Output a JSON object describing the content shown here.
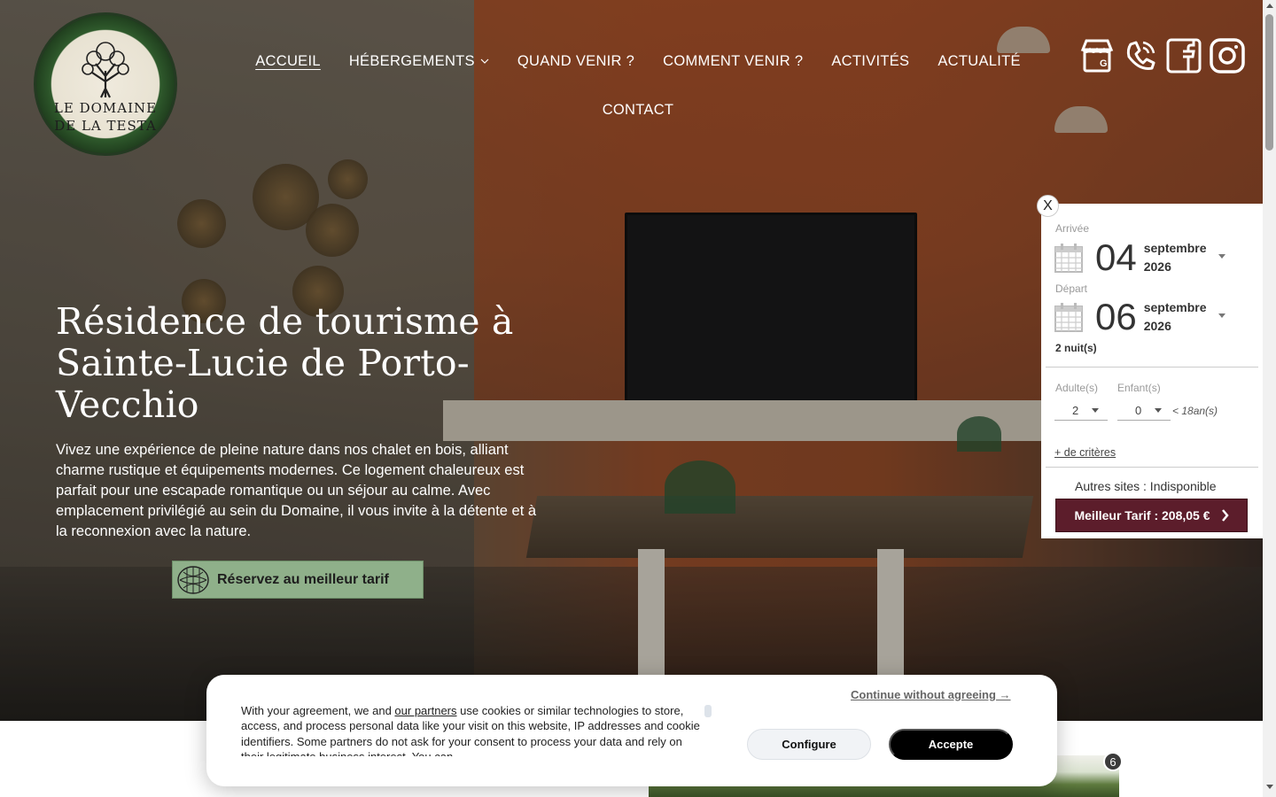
{
  "logo": {
    "line1": "Le Domaine",
    "line2": "de la Testa"
  },
  "nav": {
    "items": [
      {
        "label": "ACCUEIL"
      },
      {
        "label": "HÉBERGEMENTS"
      },
      {
        "label": "QUAND VENIR ?"
      },
      {
        "label": "COMMENT VENIR ?"
      },
      {
        "label": "ACTIVITÉS"
      },
      {
        "label": "ACTUALITÉ"
      },
      {
        "label": "CONTACT"
      }
    ],
    "active": "ACCUEIL"
  },
  "socials": [
    "google-business-icon",
    "phone-icon",
    "facebook-icon",
    "instagram-icon"
  ],
  "hero": {
    "title": "Résidence de tourisme à Sainte-Lucie de Porto-Vecchio",
    "description": "Vivez une expérience de pleine nature dans nos chalet en bois, alliant charme rustique et équipements modernes. Ce logement chaleureux est parfait pour une escapade romantique ou un séjour au calme. Avec emplacement privilégié au sein du Domaine, il vous invite à la détente et à la reconnexion avec la nature.",
    "cta": "Réservez au meilleur tarif"
  },
  "booking": {
    "close": "X",
    "arrival": {
      "label": "Arrivée",
      "day": "04",
      "month": "septembre",
      "year": "2026"
    },
    "departure": {
      "label": "Départ",
      "day": "06",
      "month": "septembre",
      "year": "2026"
    },
    "nights": "2 nuit(s)",
    "adults": {
      "label": "Adulte(s)",
      "value": "2"
    },
    "children": {
      "label": "Enfant(s)",
      "value": "0",
      "age_note": "< 18an(s)"
    },
    "more_criteria": "+ de critères",
    "other_sites": "Autres sites : Indisponible",
    "best_rate": "Meilleur Tarif : 208,05 €"
  },
  "gallery": {
    "badge": "6"
  },
  "cookie": {
    "text_before": "With your agreement, we and ",
    "partners_link": "our partners",
    "text_after": " use cookies or similar technologies to store, access, and process personal data like your visit on this website, IP addresses and cookie identifiers. Some partners do not ask for your consent to process your data and rely on their legitimate business interest. You can",
    "continue": "Continue without agreeing →",
    "configure": "Configure",
    "accept": "Accepte"
  },
  "colors": {
    "booking_button": "#5c1d2b",
    "cta_green": "#8fb08a",
    "cookie_accept": "#000000"
  }
}
